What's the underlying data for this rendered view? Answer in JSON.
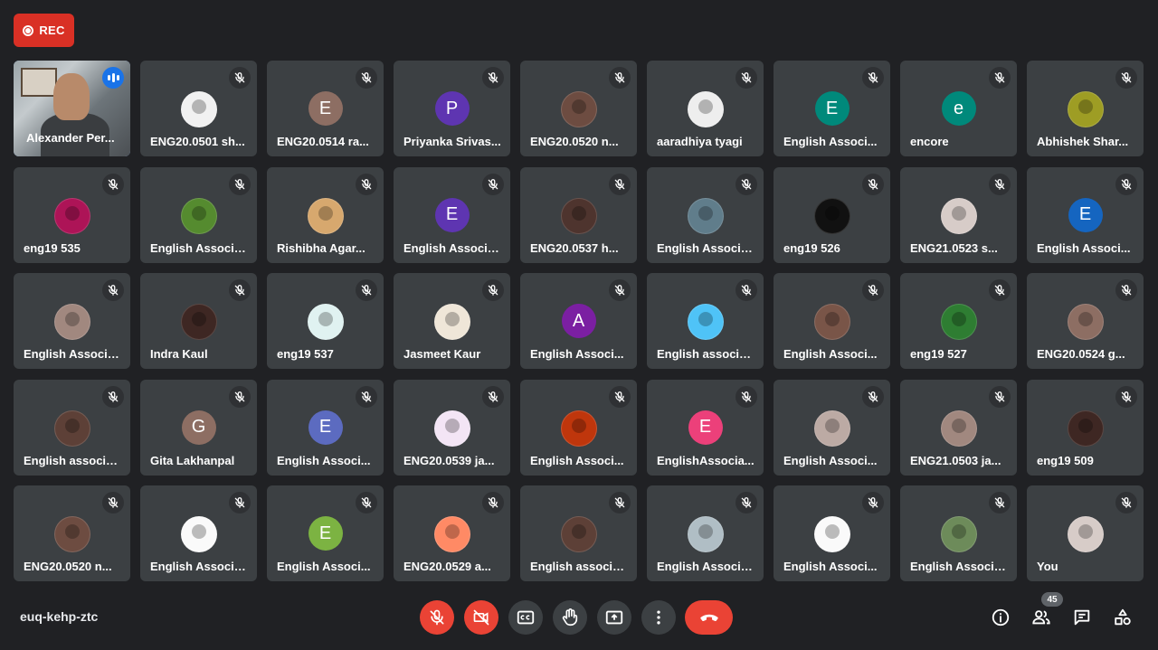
{
  "recording": {
    "label": "REC"
  },
  "tiles": [
    {
      "name": "Alexander Per...",
      "kind": "video",
      "speaking": true
    },
    {
      "name": "ENG20.0501 sh...",
      "kind": "photo",
      "bg": "#f1f1f1"
    },
    {
      "name": "ENG20.0514 ra...",
      "kind": "letter",
      "letter": "E",
      "bg": "#8d6e63"
    },
    {
      "name": "Priyanka Srivas...",
      "kind": "letter",
      "letter": "P",
      "bg": "#5e35b1"
    },
    {
      "name": "ENG20.0520 n...",
      "kind": "photo",
      "bg": "#6d4c41"
    },
    {
      "name": "aaradhiya tyagi",
      "kind": "photo",
      "bg": "#eeeeee"
    },
    {
      "name": "English Associ...",
      "kind": "letter",
      "letter": "E",
      "bg": "#00897b"
    },
    {
      "name": "encore",
      "kind": "letter",
      "letter": "e",
      "bg": "#00897b"
    },
    {
      "name": "Abhishek Shar...",
      "kind": "photo",
      "bg": "#9e9d24"
    },
    {
      "name": "eng19 535",
      "kind": "photo",
      "bg": "#ad1457"
    },
    {
      "name": "English Associa...",
      "kind": "photo",
      "bg": "#558b2f"
    },
    {
      "name": "Rishibha Agar...",
      "kind": "photo",
      "bg": "#d7a86e"
    },
    {
      "name": "English Associa...",
      "kind": "letter",
      "letter": "E",
      "bg": "#5e35b1"
    },
    {
      "name": "ENG20.0537 h...",
      "kind": "photo",
      "bg": "#4e342e"
    },
    {
      "name": "English Associa...",
      "kind": "photo",
      "bg": "#607d8b"
    },
    {
      "name": "eng19 526",
      "kind": "photo",
      "bg": "#111111"
    },
    {
      "name": "ENG21.0523 s...",
      "kind": "photo",
      "bg": "#d7ccc8"
    },
    {
      "name": "English Associ...",
      "kind": "letter",
      "letter": "E",
      "bg": "#1565c0"
    },
    {
      "name": "English Associa...",
      "kind": "photo",
      "bg": "#a1887f"
    },
    {
      "name": "Indra Kaul",
      "kind": "photo",
      "bg": "#3e2723"
    },
    {
      "name": "eng19 537",
      "kind": "photo",
      "bg": "#e0f2f1"
    },
    {
      "name": "Jasmeet Kaur",
      "kind": "photo",
      "bg": "#efe6d8"
    },
    {
      "name": "English Associ...",
      "kind": "letter",
      "letter": "A",
      "bg": "#7b1fa2"
    },
    {
      "name": "English associa...",
      "kind": "photo",
      "bg": "#4fc3f7"
    },
    {
      "name": "English Associ...",
      "kind": "photo",
      "bg": "#795548"
    },
    {
      "name": "eng19 527",
      "kind": "photo",
      "bg": "#2e7d32"
    },
    {
      "name": "ENG20.0524 g...",
      "kind": "photo",
      "bg": "#8d6e63"
    },
    {
      "name": "English associa...",
      "kind": "photo",
      "bg": "#5d4037"
    },
    {
      "name": "Gita Lakhanpal",
      "kind": "letter",
      "letter": "G",
      "bg": "#8d6e63"
    },
    {
      "name": "English Associ...",
      "kind": "letter",
      "letter": "E",
      "bg": "#5c6bc0"
    },
    {
      "name": "ENG20.0539 ja...",
      "kind": "photo",
      "bg": "#f3e5f5"
    },
    {
      "name": "English Associ...",
      "kind": "photo",
      "bg": "#bf360c"
    },
    {
      "name": "EnglishAssocia...",
      "kind": "letter",
      "letter": "E",
      "bg": "#ec407a"
    },
    {
      "name": "English Associ...",
      "kind": "photo",
      "bg": "#bcaaa4"
    },
    {
      "name": "ENG21.0503 ja...",
      "kind": "photo",
      "bg": "#a1887f"
    },
    {
      "name": "eng19 509",
      "kind": "photo",
      "bg": "#3e2723"
    },
    {
      "name": "ENG20.0520 n...",
      "kind": "photo",
      "bg": "#6d4c41"
    },
    {
      "name": "English Associa...",
      "kind": "photo",
      "bg": "#fafafa"
    },
    {
      "name": "English Associ...",
      "kind": "letter",
      "letter": "E",
      "bg": "#7cb342"
    },
    {
      "name": "ENG20.0529 a...",
      "kind": "photo",
      "bg": "#ff8a65"
    },
    {
      "name": "English associa...",
      "kind": "photo",
      "bg": "#5d4037"
    },
    {
      "name": "English Associa...",
      "kind": "photo",
      "bg": "#b0bec5"
    },
    {
      "name": "English Associ...",
      "kind": "photo",
      "bg": "#fafafa"
    },
    {
      "name": "English Associa...",
      "kind": "photo",
      "bg": "#6d8b5a"
    },
    {
      "name": "You",
      "kind": "photo",
      "bg": "#d7ccc8",
      "self": true
    }
  ],
  "bottom_bar": {
    "meeting_code": "euq-kehp-ztc",
    "participant_count": "45"
  }
}
